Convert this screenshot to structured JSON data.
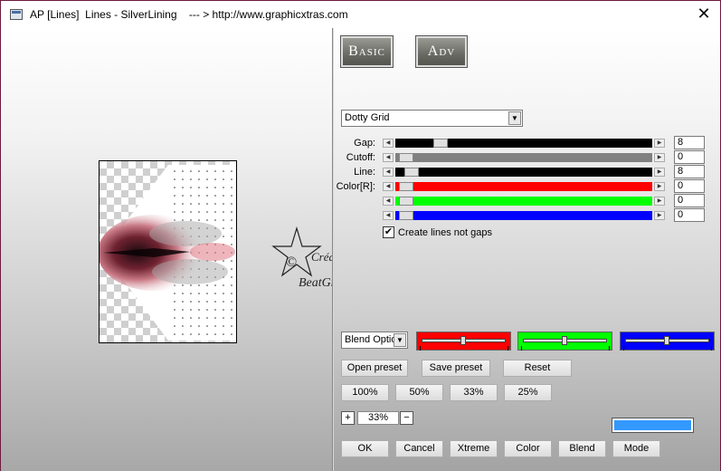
{
  "window": {
    "title": "AP [Lines]  Lines - SilverLining    --- > http://www.graphicxtras.com",
    "close_symbol": "✕"
  },
  "tabs": [
    {
      "label": "Basic"
    },
    {
      "label": "Adv"
    }
  ],
  "mode_select": {
    "value": "Dotty Grid"
  },
  "sliders": [
    {
      "label": "Gap:",
      "value": "8",
      "color": "#000000"
    },
    {
      "label": "Cutoff:",
      "value": "0",
      "color": "#808080"
    },
    {
      "label": "Line:",
      "value": "8",
      "color": "#000000"
    },
    {
      "label": "Color[R]:",
      "value": "0",
      "color": "#ff0000"
    },
    {
      "label": "",
      "value": "0",
      "color": "#00ff00"
    },
    {
      "label": "",
      "value": "0",
      "color": "#0000ff"
    }
  ],
  "checkbox": {
    "label": "Create lines not gaps",
    "checked": true,
    "mark": "✔"
  },
  "blend_select": {
    "value": "Blend Optio"
  },
  "blend_colors": [
    "#ff0000",
    "#00ff00",
    "#0000ff"
  ],
  "preset_buttons": {
    "open": "Open preset",
    "save": "Save preset",
    "reset": "Reset"
  },
  "zoom_buttons": [
    "100%",
    "50%",
    "33%",
    "25%"
  ],
  "zoom": {
    "plus": "+",
    "value": "33%",
    "minus": "−"
  },
  "swatch_color": "#3399ff",
  "bottom_buttons": [
    "OK",
    "Cancel",
    "Xtreme",
    "Color",
    "Blend",
    "Mode"
  ],
  "watermark": {
    "line1": "Créations",
    "line2": "BeatGraph",
    "symbol": "©"
  }
}
